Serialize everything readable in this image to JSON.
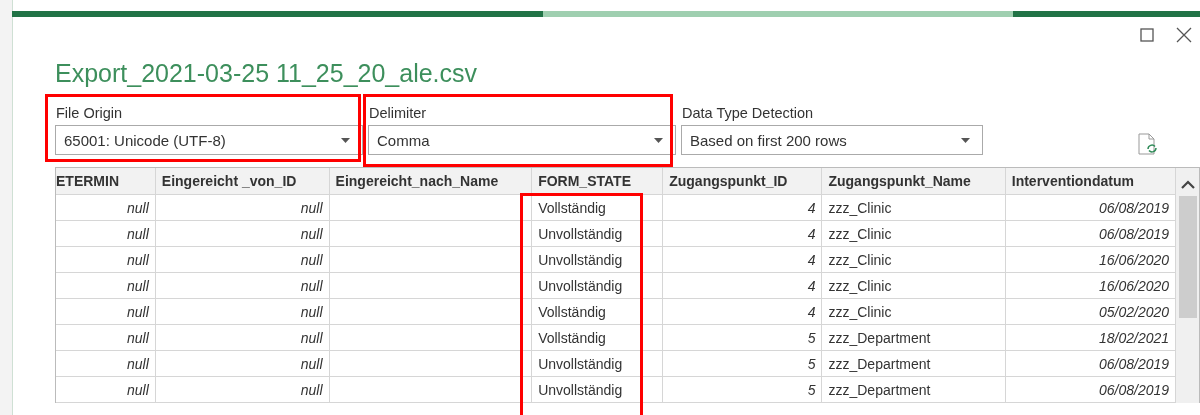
{
  "window": {
    "title": "Export_2021-03-25 11_25_20_ale.csv"
  },
  "settings": [
    {
      "label": "File Origin",
      "value": "65001: Unicode (UTF-8)"
    },
    {
      "label": "Delimiter",
      "value": "Comma"
    },
    {
      "label": "Data Type Detection",
      "value": "Based on first 200 rows"
    }
  ],
  "table": {
    "columns": [
      {
        "name": "ETERMIN",
        "kind": "number"
      },
      {
        "name": "Eingereicht _von_ID",
        "kind": "number"
      },
      {
        "name": "Eingereicht_nach_Name",
        "kind": "text"
      },
      {
        "name": "FORM_STATE",
        "kind": "text"
      },
      {
        "name": "Zugangspunkt_ID",
        "kind": "number"
      },
      {
        "name": "Zugangspunkt_Name",
        "kind": "text"
      },
      {
        "name": "Interventiondatum",
        "kind": "number"
      }
    ],
    "rows": [
      [
        "null",
        "null",
        "",
        "Vollständig",
        "4",
        "zzz_Clinic",
        "06/08/2019"
      ],
      [
        "null",
        "null",
        "",
        "Unvollständig",
        "4",
        "zzz_Clinic",
        "06/08/2019"
      ],
      [
        "null",
        "null",
        "",
        "Unvollständig",
        "4",
        "zzz_Clinic",
        "16/06/2020"
      ],
      [
        "null",
        "null",
        "",
        "Unvollständig",
        "4",
        "zzz_Clinic",
        "16/06/2020"
      ],
      [
        "null",
        "null",
        "",
        "Vollständig",
        "4",
        "zzz_Clinic",
        "05/02/2020"
      ],
      [
        "null",
        "null",
        "",
        "Vollständig",
        "5",
        "zzz_Department",
        "18/02/2021"
      ],
      [
        "null",
        "null",
        "",
        "Unvollständig",
        "5",
        "zzz_Department",
        "06/08/2019"
      ],
      [
        "null",
        "null",
        "",
        "Unvollständig",
        "5",
        "zzz_Department",
        "06/08/2019"
      ]
    ]
  }
}
